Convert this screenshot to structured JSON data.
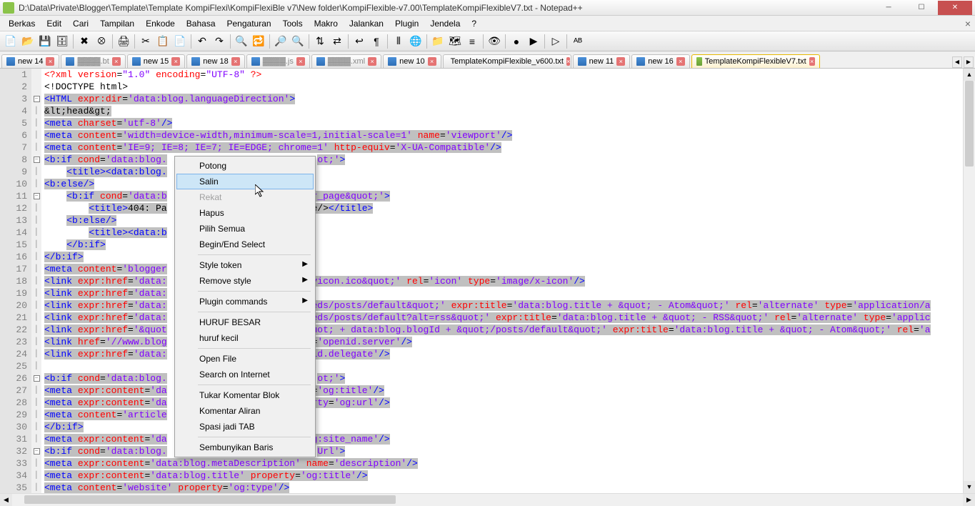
{
  "title": "D:\\Data\\Private\\Blogger\\Template\\Template KompiFlexi\\KompiFlexiBle v7\\New folder\\KompiFlexible-v7.00\\TemplateKompiFlexibleV7.txt - Notepad++",
  "menus": [
    "Berkas",
    "Edit",
    "Cari",
    "Tampilan",
    "Enkode",
    "Bahasa",
    "Pengaturan",
    "Tools",
    "Makro",
    "Jalankan",
    "Plugin",
    "Jendela",
    "?"
  ],
  "tabs": [
    {
      "label": "new 14",
      "icon": "blue",
      "close": true
    },
    {
      "label": ".bt",
      "icon": "blue",
      "close": true,
      "obscured": true
    },
    {
      "label": "new 15",
      "icon": "blue",
      "close": true
    },
    {
      "label": "new 18",
      "icon": "blue",
      "close": true
    },
    {
      "label": ".js",
      "icon": "blue",
      "close": true,
      "obscured": true
    },
    {
      "label": ".xml",
      "icon": "blue",
      "close": true,
      "obscured": true
    },
    {
      "label": "new 10",
      "icon": "blue",
      "close": true
    },
    {
      "label": "TemplateKompiFlexible_v600.txt",
      "icon": "blue",
      "close": true
    },
    {
      "label": "new 11",
      "icon": "blue",
      "close": true
    },
    {
      "label": "new 16",
      "icon": "blue",
      "close": true
    },
    {
      "label": "TemplateKompiFlexibleV7.txt",
      "icon": "green",
      "close": true,
      "active": true
    }
  ],
  "context_menu": {
    "items": [
      {
        "label": "Potong",
        "type": "item"
      },
      {
        "label": "Salin",
        "type": "item",
        "hover": true
      },
      {
        "label": "Rekat",
        "type": "item",
        "disabled": true
      },
      {
        "label": "Hapus",
        "type": "item"
      },
      {
        "label": "Pilih Semua",
        "type": "item"
      },
      {
        "label": "Begin/End Select",
        "type": "item"
      },
      {
        "type": "sep"
      },
      {
        "label": "Style token",
        "type": "sub"
      },
      {
        "label": "Remove style",
        "type": "sub"
      },
      {
        "type": "sep"
      },
      {
        "label": "Plugin commands",
        "type": "sub"
      },
      {
        "type": "sep"
      },
      {
        "label": "HURUF BESAR",
        "type": "item"
      },
      {
        "label": "huruf kecil",
        "type": "item"
      },
      {
        "type": "sep"
      },
      {
        "label": "Open File",
        "type": "item"
      },
      {
        "label": "Search on Internet",
        "type": "item"
      },
      {
        "type": "sep"
      },
      {
        "label": "Tukar Komentar Blok",
        "type": "item"
      },
      {
        "label": "Komentar Aliran",
        "type": "item"
      },
      {
        "label": "Spasi jadi TAB",
        "type": "item"
      },
      {
        "type": "sep"
      },
      {
        "label": "Sembunyikan Baris",
        "type": "item"
      }
    ]
  },
  "code_lines": [
    {
      "n": 1,
      "fold": "",
      "html": "<span class='pi'>&lt;?xml</span> <span class='attr'>version</span>=<span class='str'>\"1.0\"</span> <span class='attr'>encoding</span>=<span class='str'>\"UTF-8\"</span> <span class='pi'>?&gt;</span>"
    },
    {
      "n": 2,
      "fold": "",
      "html": "<span class='txt'>&lt;!DOCTYPE html&gt;</span>"
    },
    {
      "n": 3,
      "fold": "[-]",
      "html": "<span class='sel'><span class='tag'>&lt;HTML</span> <span class='attr'>expr:dir</span>=<span class='str'>'data:blog.languageDirection'</span><span class='tag'>&gt;</span></span>"
    },
    {
      "n": 4,
      "fold": "|",
      "html": "<span class='sel'><span class='ent'>&amp;lt;head&amp;gt;</span></span>"
    },
    {
      "n": 5,
      "fold": "|",
      "html": "<span class='sel'><span class='tag'>&lt;meta</span> <span class='attr'>charset</span>=<span class='str'>'utf-8'</span><span class='tag'>/&gt;</span></span>"
    },
    {
      "n": 6,
      "fold": "|",
      "html": "<span class='sel'><span class='tag'>&lt;meta</span> <span class='attr'>content</span>=<span class='str'>'width=device-width,minimum-scale=1,initial-scale=1'</span> <span class='attr'>name</span>=<span class='str'>'viewport'</span><span class='tag'>/&gt;</span></span>"
    },
    {
      "n": 7,
      "fold": "|",
      "html": "<span class='sel'><span class='tag'>&lt;meta</span> <span class='attr'>content</span>=<span class='str'>'IE=9; IE=8; IE=7; IE=EDGE; chrome=1'</span> <span class='attr'>http-equiv</span>=<span class='str'>'X-UA-Compatible'</span><span class='tag'>/&gt;</span></span>"
    },
    {
      "n": 8,
      "fold": "[-]",
      "html": "<span class='sel'><span class='tag'>&lt;b:if</span> <span class='attr'>cond</span>=<span class='str'>'data:blog.</span></span>                           <span class='sel'><span class='str'>ot;'</span><span class='tag'>&gt;</span></span>"
    },
    {
      "n": 9,
      "fold": "|",
      "html": "    <span class='sel'><span class='tag'>&lt;title&gt;&lt;data:blog.</span></span>"
    },
    {
      "n": 10,
      "fold": "|",
      "html": "<span class='sel'><span class='tag'>&lt;b:else/&gt;</span></span>"
    },
    {
      "n": 11,
      "fold": "[-]",
      "html": "    <span class='sel'><span class='tag'>&lt;b:if</span> <span class='attr'>cond</span>=<span class='str'>'data:b</span></span>                         <span class='sel'><span class='str'>or_page&amp;quot;'</span><span class='tag'>&gt;</span></span>"
    },
    {
      "n": 12,
      "fold": "|",
      "html": "        <span class='sel'><span class='tag'>&lt;title&gt;</span><span class='txt'>404: Pa</span></span>                     <span class='sel'><span class='txt'>.title/&gt;</span><span class='tag'>&lt;/title&gt;</span></span>"
    },
    {
      "n": 13,
      "fold": "|",
      "html": "    <span class='sel'><span class='tag'>&lt;b:else/&gt;</span></span>"
    },
    {
      "n": 14,
      "fold": "|",
      "html": "        <span class='sel'><span class='tag'>&lt;title&gt;&lt;data:b</span></span>"
    },
    {
      "n": 15,
      "fold": "|",
      "html": "    <span class='sel'><span class='tag'>&lt;/b:if&gt;</span></span>"
    },
    {
      "n": 16,
      "fold": "|",
      "html": "<span class='sel'><span class='tag'>&lt;/b:if&gt;</span></span>"
    },
    {
      "n": 17,
      "fold": "|",
      "html": "<span class='sel'><span class='tag'>&lt;meta</span> <span class='attr'>content</span>=<span class='str'>'blogger</span></span>"
    },
    {
      "n": 18,
      "fold": "|",
      "html": "<span class='sel'><span class='tag'>&lt;link</span> <span class='attr'>expr:href</span>=<span class='str'>'data:</span></span>                        <span class='sel'><span class='str'>favicon.ico&amp;quot;'</span> <span class='attr'>rel</span>=<span class='str'>'icon'</span> <span class='attr'>type</span>=<span class='str'>'image/x-icon'</span><span class='tag'>/&gt;</span></span>"
    },
    {
      "n": 19,
      "fold": "|",
      "html": "<span class='sel'><span class='tag'>&lt;link</span> <span class='attr'>expr:href</span>=<span class='str'>'data:</span></span>"
    },
    {
      "n": 20,
      "fold": "|",
      "html": "<span class='sel'><span class='tag'>&lt;link</span> <span class='attr'>expr:href</span>=<span class='str'>'data:</span></span>                        <span class='sel'><span class='str'>feeds/posts/default&amp;quot;'</span> <span class='attr'>expr:title</span>=<span class='str'>'data:blog.title + &amp;quot; - Atom&amp;quot;'</span> <span class='attr'>rel</span>=<span class='str'>'alternate'</span> <span class='attr'>type</span>=<span class='str'>'application/a</span></span>"
    },
    {
      "n": 21,
      "fold": "|",
      "html": "<span class='sel'><span class='tag'>&lt;link</span> <span class='attr'>expr:href</span>=<span class='str'>'data:</span></span>                        <span class='sel'><span class='str'>feeds/posts/default?alt=rss&amp;quot;'</span> <span class='attr'>expr:title</span>=<span class='str'>'data:blog.title + &amp;quot; - RSS&amp;quot;'</span> <span class='attr'>rel</span>=<span class='str'>'alternate'</span> <span class='attr'>type</span>=<span class='str'>'applic</span></span>"
    },
    {
      "n": 22,
      "fold": "|",
      "html": "<span class='sel'><span class='tag'>&lt;link</span> <span class='attr'>expr:href</span>=<span class='str'>'&amp;quot</span></span>                        <span class='sel'><span class='str'>&amp;quot; + data:blog.blogId + &amp;quot;/posts/default&amp;quot;'</span> <span class='attr'>expr:title</span>=<span class='str'>'data:blog.title + &amp;quot; - Atom&amp;quot;'</span> <span class='attr'>rel</span>=<span class='str'>'a</span></span>"
    },
    {
      "n": 23,
      "fold": "|",
      "html": "<span class='sel'><span class='tag'>&lt;link</span> <span class='attr'>href</span>=<span class='str'>'//www.blog</span></span>                        <span class='sel'><span class='attr'>el</span>=<span class='str'>'openid.server'</span><span class='tag'>/&gt;</span></span>"
    },
    {
      "n": 24,
      "fold": "|",
      "html": "<span class='sel'><span class='tag'>&lt;link</span> <span class='attr'>expr:href</span>=<span class='str'>'data:</span></span>                        <span class='sel'><span class='str'>enid.delegate'</span><span class='tag'>/&gt;</span></span>"
    },
    {
      "n": 25,
      "fold": "|",
      "html": ""
    },
    {
      "n": 26,
      "fold": "[-]",
      "html": "<span class='sel'><span class='tag'>&lt;b:if</span> <span class='attr'>cond</span>=<span class='str'>'data:blog.</span></span>                           <span class='sel'><span class='str'>ot;'</span><span class='tag'>&gt;</span></span>"
    },
    {
      "n": 27,
      "fold": "|",
      "html": "<span class='sel'><span class='tag'>&lt;meta</span> <span class='attr'>expr:content</span>=<span class='str'>'da</span></span>                        <span class='sel'><span class='str'>ty</span>=<span class='str'>'og:title'</span><span class='tag'>/&gt;</span></span>"
    },
    {
      "n": 28,
      "fold": "|",
      "html": "<span class='sel'><span class='tag'>&lt;meta</span> <span class='attr'>expr:content</span>=<span class='str'>'da</span></span>                        <span class='sel'><span class='str'>perty</span>=<span class='str'>'og:url'</span><span class='tag'>/&gt;</span></span>"
    },
    {
      "n": 29,
      "fold": "|",
      "html": "<span class='sel'><span class='tag'>&lt;meta</span> <span class='attr'>content</span>=<span class='str'>'article</span></span>"
    },
    {
      "n": 30,
      "fold": "|",
      "html": "<span class='sel'><span class='tag'>&lt;/b:if&gt;</span></span>"
    },
    {
      "n": 31,
      "fold": "|",
      "html": "<span class='sel'><span class='tag'>&lt;meta</span> <span class='attr'>expr:content</span>=<span class='str'>'da</span></span>                        <span class='sel'><span class='str'>log:site_name'</span><span class='tag'>/&gt;</span></span>"
    },
    {
      "n": 32,
      "fold": "[-]",
      "html": "<span class='sel'><span class='tag'>&lt;b:if</span> <span class='attr'>cond</span>=<span class='str'>'data:blog.</span></span>                           <span class='sel'><span class='str'>Url'</span><span class='tag'>&gt;</span></span>"
    },
    {
      "n": 33,
      "fold": "|",
      "html": "<span class='sel'><span class='tag'>&lt;meta</span> <span class='attr'>expr:content</span>=<span class='str'>'data:blog.metaDescription'</span> <span class='attr'>name</span>=<span class='str'>'description'</span><span class='tag'>/&gt;</span></span>"
    },
    {
      "n": 34,
      "fold": "|",
      "html": "<span class='sel'><span class='tag'>&lt;meta</span> <span class='attr'>expr:content</span>=<span class='str'>'data:blog.title'</span> <span class='attr'>property</span>=<span class='str'>'og:title'</span><span class='tag'>/&gt;</span></span>"
    },
    {
      "n": 35,
      "fold": "|",
      "html": "<span class='sel'><span class='tag'>&lt;meta</span> <span class='attr'>content</span>=<span class='str'>'website'</span> <span class='attr'>property</span>=<span class='str'>'og:type'</span><span class='tag'>/&gt;</span></span>"
    }
  ],
  "toolbar_icons": [
    "new-file",
    "open-file",
    "save",
    "save-all",
    "|",
    "close",
    "close-all",
    "|",
    "print",
    "|",
    "cut",
    "copy",
    "paste",
    "|",
    "undo",
    "redo",
    "|",
    "find",
    "replace",
    "|",
    "zoom-in",
    "zoom-out",
    "|",
    "sync-v",
    "sync-h",
    "|",
    "word-wrap",
    "show-chars",
    "|",
    "indent-guide",
    "lang",
    "|",
    "folder",
    "doc-map",
    "func-list",
    "|",
    "monitor",
    "|",
    "record",
    "play",
    "|",
    "run",
    "|",
    "spell-check"
  ]
}
